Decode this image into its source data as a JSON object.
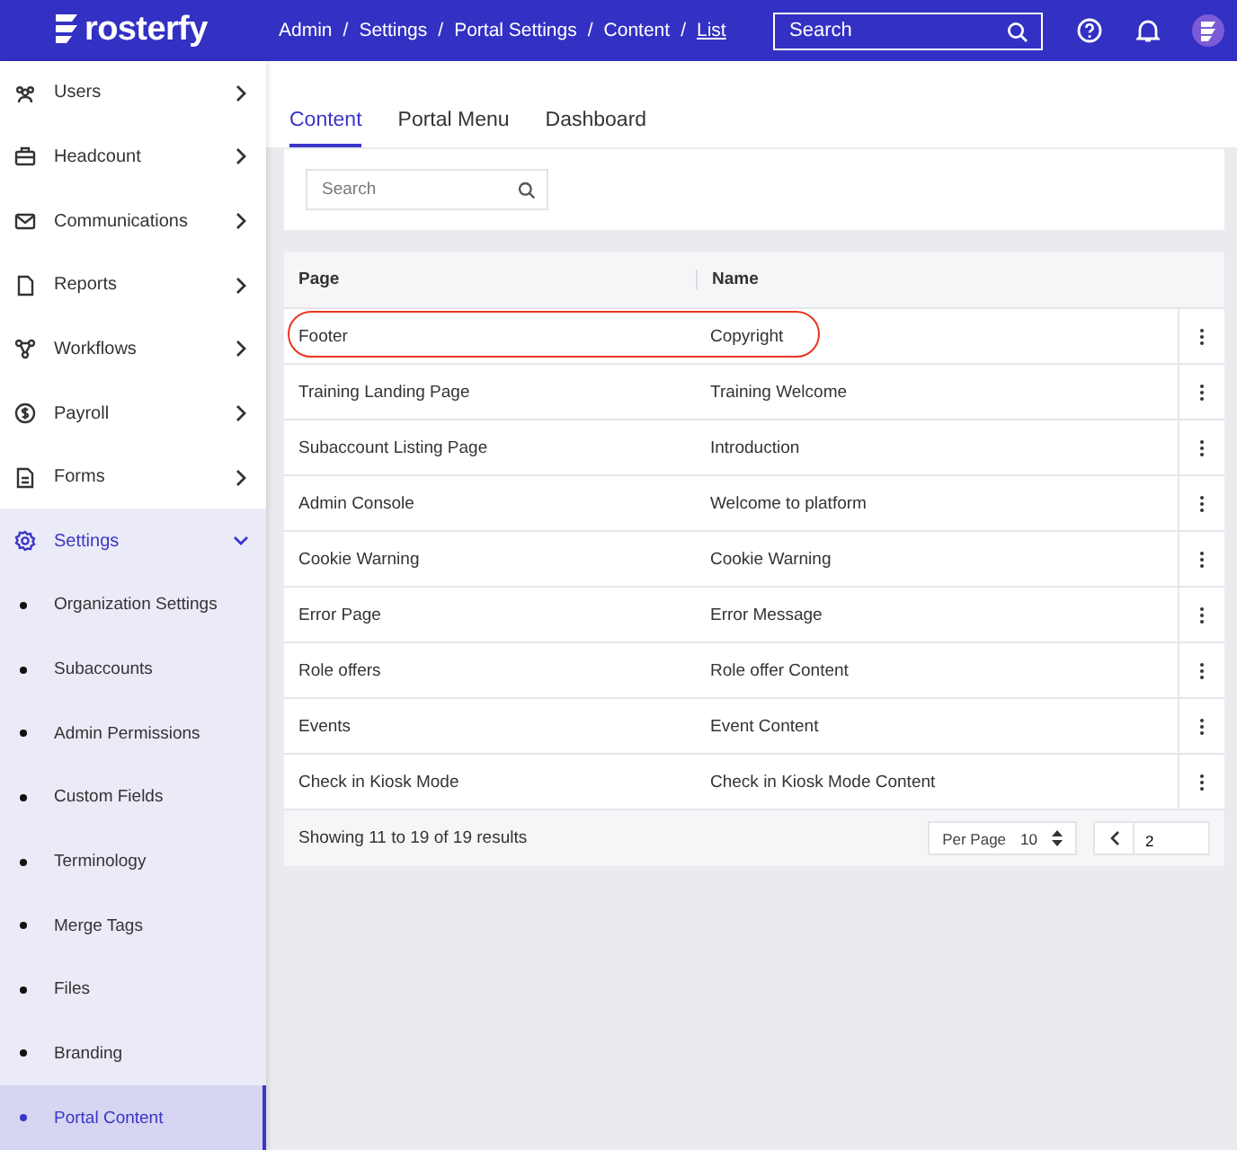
{
  "header": {
    "logo": "rosterfy",
    "breadcrumb": [
      "Admin",
      "Settings",
      "Portal Settings",
      "Content",
      "List"
    ],
    "separator": "/",
    "search": {
      "placeholder": "Search"
    }
  },
  "sidebar": {
    "items": [
      {
        "label": "Users",
        "expanded": false
      },
      {
        "label": "Headcount",
        "expanded": false
      },
      {
        "label": "Communications",
        "expanded": false
      },
      {
        "label": "Reports",
        "expanded": false
      },
      {
        "label": "Workflows",
        "expanded": false
      },
      {
        "label": "Payroll",
        "expanded": false
      },
      {
        "label": "Forms",
        "expanded": false
      },
      {
        "label": "Settings",
        "expanded": true,
        "children": [
          {
            "label": "Organization Settings",
            "selected": false
          },
          {
            "label": "Subaccounts",
            "selected": false
          },
          {
            "label": "Admin Permissions",
            "selected": false
          },
          {
            "label": "Custom Fields",
            "selected": false
          },
          {
            "label": "Terminology",
            "selected": false
          },
          {
            "label": "Merge Tags",
            "selected": false
          },
          {
            "label": "Files",
            "selected": false
          },
          {
            "label": "Branding",
            "selected": false
          },
          {
            "label": "Portal Content",
            "selected": true
          }
        ]
      }
    ]
  },
  "tabs": [
    {
      "label": "Content",
      "selected": true
    },
    {
      "label": "Portal Menu",
      "selected": false
    },
    {
      "label": "Dashboard",
      "selected": false
    }
  ],
  "filter": {
    "search": {
      "placeholder": "Search"
    }
  },
  "table": {
    "columns": [
      "Page",
      "Name"
    ],
    "rows": [
      {
        "page": "Footer",
        "name": "Copyright",
        "circled": true
      },
      {
        "page": "Training Landing Page",
        "name": "Training Welcome",
        "circled": false
      },
      {
        "page": "Subaccount Listing Page",
        "name": "Introduction",
        "circled": false
      },
      {
        "page": "Admin Console",
        "name": "Welcome to platform",
        "circled": false
      },
      {
        "page": "Cookie Warning",
        "name": "Cookie Warning",
        "circled": false
      },
      {
        "page": "Error Page",
        "name": "Error Message",
        "circled": false
      },
      {
        "page": "Role offers",
        "name": "Role offer Content",
        "circled": false
      },
      {
        "page": "Events",
        "name": "Event Content",
        "circled": false
      },
      {
        "page": "Check in Kiosk Mode",
        "name": "Check in Kiosk Mode Content",
        "circled": false
      }
    ]
  },
  "pagination": {
    "summary": "Showing 11 to 19 of 19 results",
    "per_page_label": "Per Page",
    "per_page": "10",
    "page": "2"
  }
}
